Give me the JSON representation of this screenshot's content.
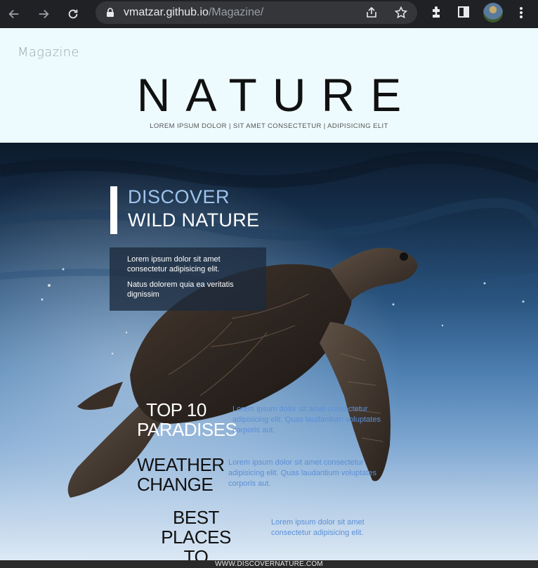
{
  "browser": {
    "url_host": "vmatzar.github.io",
    "url_path": "/Magazine/",
    "icons": [
      "back-icon",
      "forward-icon",
      "reload-icon",
      "lock-icon",
      "share-icon",
      "star-icon",
      "extensions-icon",
      "side-panel-icon",
      "profile-avatar",
      "menu-icon"
    ]
  },
  "header": {
    "brand": "Magazine",
    "title": "NATURE",
    "tagline": "LOREM IPSUM DOLOR | SIT AMET CONSECTETUR | ADIPISICING ELIT"
  },
  "hero": {
    "discover_line1": "DISCOVER",
    "discover_line2": "WILD NATURE",
    "note_p1": "Lorem ipsum dolor sit amet consectetur adipisicing elit.",
    "note_p2": "Natus dolorem quia ea veritatis dignissim",
    "articles": [
      {
        "title": "TOP 10 PARADISES",
        "text": "Lorem ipsum dolor sit amet consectetur adipisicing elit. Quas laudantium voluptates corporis aut."
      },
      {
        "title": "WEATHER CHANGE",
        "text": "Lorem ipsum dolor sit amet consectetur adipisicing elit. Quas laudantium voluptates corporis aut."
      },
      {
        "title": "BEST PLACES TO TRAVEL",
        "text": "Lorem ipsum dolor sit amet consectetur adipisicing elit."
      }
    ]
  },
  "footer": {
    "text": "WWW.DISCOVERNATURE.COM"
  },
  "colors": {
    "accent_blue": "#5b8fd6",
    "header_bg": "#eefbfe",
    "chrome_bg": "#202124"
  }
}
